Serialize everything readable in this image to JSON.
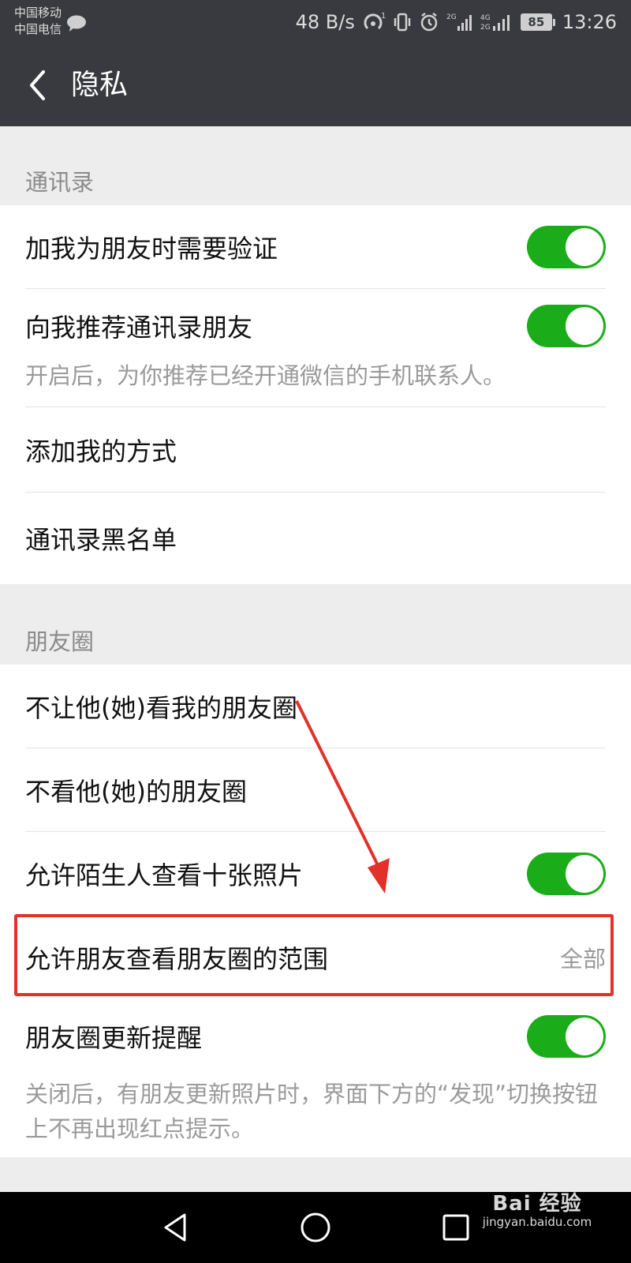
{
  "status_bar": {
    "carrier_1": "中国移动",
    "carrier_2": "中国电信",
    "network_speed": "48 B/s",
    "battery_level": "85",
    "time": "13:26",
    "icons": [
      "wechat-bubble-icon",
      "hotspot-icon",
      "vibrate-icon",
      "alarm-icon",
      "signal-2g-icon",
      "signal-4g-icon"
    ]
  },
  "header": {
    "title": "隐私",
    "back_icon": "chevron-left-icon"
  },
  "contacts_section": {
    "header": "通讯录",
    "rows": [
      {
        "label": "加我为朋友时需要验证",
        "toggle_on": true
      },
      {
        "label": "向我推荐通讯录朋友",
        "toggle_on": true
      },
      {
        "label": "添加我的方式"
      },
      {
        "label": "通讯录黑名单"
      }
    ],
    "recommend_hint": "开启后，为你推荐已经开通微信的手机联系人。"
  },
  "moments_section": {
    "header": "朋友圈",
    "rows": [
      {
        "label": "不让他(她)看我的朋友圈"
      },
      {
        "label": "不看他(她)的朋友圈"
      },
      {
        "label": "允许陌生人查看十张照片",
        "toggle_on": true
      },
      {
        "label": "允许朋友查看朋友圈的范围",
        "value": "全部"
      },
      {
        "label": "朋友圈更新提醒",
        "toggle_on": true
      }
    ],
    "update_hint": "关闭后，有朋友更新照片时，界面下方的“发现”切换按钮上不再出现红点提示。"
  },
  "annotation": {
    "highlight_color": "#e2312b",
    "arrow_color": "#e2312b"
  },
  "system_nav": {
    "buttons": [
      "back-triangle-icon",
      "home-circle-icon",
      "recents-square-icon"
    ]
  },
  "watermark": {
    "logo": "Bai 经验",
    "url": "jingyan.baidu.com"
  },
  "colors": {
    "bar_background": "#393a3f",
    "toggle_on": "#1aad19",
    "page_background": "#ededed"
  }
}
